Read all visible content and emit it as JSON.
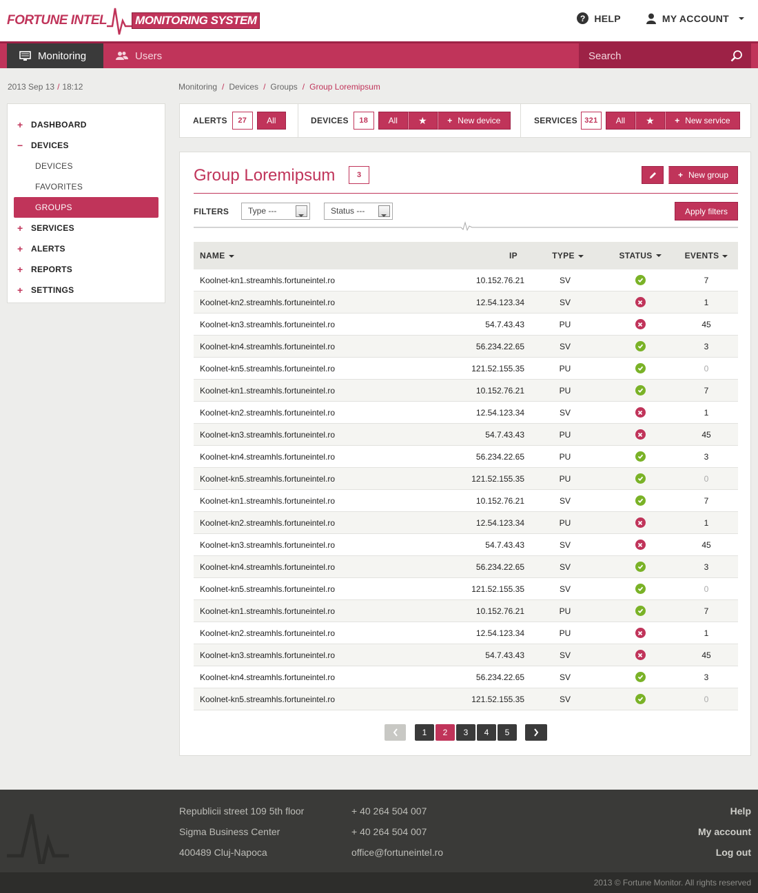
{
  "header": {
    "logo_left": "FORTUNE INTEL",
    "logo_right": "MONITORING SYSTEM",
    "help": "HELP",
    "account": "MY ACCOUNT"
  },
  "nav": {
    "monitoring": "Monitoring",
    "users": "Users",
    "search_placeholder": "Search"
  },
  "datetime": {
    "date": "2013 Sep 13",
    "time": "18:12"
  },
  "breadcrumb": [
    "Monitoring",
    "Devices",
    "Groups",
    "Group Loremipsum"
  ],
  "sidebar": {
    "dashboard": "DASHBOARD",
    "devices": "DEVICES",
    "devices_sub": "DEVICES",
    "favorites": "FAVORITES",
    "groups": "GROUPS",
    "services": "SERVICES",
    "alerts": "ALERTS",
    "reports": "REPORTS",
    "settings": "SETTINGS"
  },
  "stats": {
    "alerts_label": "ALERTS",
    "alerts_count": "27",
    "alerts_all": "All",
    "devices_label": "DEVICES",
    "devices_count": "18",
    "devices_all": "All",
    "new_device": "New device",
    "services_label": "SERVICES",
    "services_count": "321",
    "services_all": "All",
    "new_service": "New service"
  },
  "group": {
    "title": "Group Loremipsum",
    "count": "3",
    "new_group": "New group",
    "filters_label": "FILTERS",
    "type_select": "Type ---",
    "status_select": "Status ---",
    "apply": "Apply filters"
  },
  "table": {
    "headers": {
      "name": "NAME",
      "ip": "IP",
      "type": "TYPE",
      "status": "STATUS",
      "events": "EVENTS"
    },
    "rows": [
      {
        "name": "Koolnet-kn1.streamhls.fortuneintel.ro",
        "ip": "10.152.76.21",
        "type": "SV",
        "status": "ok",
        "events": "7"
      },
      {
        "name": "Koolnet-kn2.streamhls.fortuneintel.ro",
        "ip": "12.54.123.34",
        "type": "SV",
        "status": "error",
        "events": "1"
      },
      {
        "name": "Koolnet-kn3.streamhls.fortuneintel.ro",
        "ip": "54.7.43.43",
        "type": "PU",
        "status": "error",
        "events": "45"
      },
      {
        "name": "Koolnet-kn4.streamhls.fortuneintel.ro",
        "ip": "56.234.22.65",
        "type": "SV",
        "status": "ok",
        "events": "3"
      },
      {
        "name": "Koolnet-kn5.streamhls.fortuneintel.ro",
        "ip": "121.52.155.35",
        "type": "PU",
        "status": "ok",
        "events": "0"
      },
      {
        "name": "Koolnet-kn1.streamhls.fortuneintel.ro",
        "ip": "10.152.76.21",
        "type": "PU",
        "status": "ok",
        "events": "7"
      },
      {
        "name": "Koolnet-kn2.streamhls.fortuneintel.ro",
        "ip": "12.54.123.34",
        "type": "SV",
        "status": "error",
        "events": "1"
      },
      {
        "name": "Koolnet-kn3.streamhls.fortuneintel.ro",
        "ip": "54.7.43.43",
        "type": "PU",
        "status": "error",
        "events": "45"
      },
      {
        "name": "Koolnet-kn4.streamhls.fortuneintel.ro",
        "ip": "56.234.22.65",
        "type": "PU",
        "status": "ok",
        "events": "3"
      },
      {
        "name": "Koolnet-kn5.streamhls.fortuneintel.ro",
        "ip": "121.52.155.35",
        "type": "PU",
        "status": "ok",
        "events": "0"
      },
      {
        "name": "Koolnet-kn1.streamhls.fortuneintel.ro",
        "ip": "10.152.76.21",
        "type": "SV",
        "status": "ok",
        "events": "7"
      },
      {
        "name": "Koolnet-kn2.streamhls.fortuneintel.ro",
        "ip": "12.54.123.34",
        "type": "PU",
        "status": "error",
        "events": "1"
      },
      {
        "name": "Koolnet-kn3.streamhls.fortuneintel.ro",
        "ip": "54.7.43.43",
        "type": "SV",
        "status": "error",
        "events": "45"
      },
      {
        "name": "Koolnet-kn4.streamhls.fortuneintel.ro",
        "ip": "56.234.22.65",
        "type": "SV",
        "status": "ok",
        "events": "3"
      },
      {
        "name": "Koolnet-kn5.streamhls.fortuneintel.ro",
        "ip": "121.52.155.35",
        "type": "SV",
        "status": "ok",
        "events": "0"
      },
      {
        "name": "Koolnet-kn1.streamhls.fortuneintel.ro",
        "ip": "10.152.76.21",
        "type": "PU",
        "status": "ok",
        "events": "7"
      },
      {
        "name": "Koolnet-kn2.streamhls.fortuneintel.ro",
        "ip": "12.54.123.34",
        "type": "PU",
        "status": "error",
        "events": "1"
      },
      {
        "name": "Koolnet-kn3.streamhls.fortuneintel.ro",
        "ip": "54.7.43.43",
        "type": "SV",
        "status": "error",
        "events": "45"
      },
      {
        "name": "Koolnet-kn4.streamhls.fortuneintel.ro",
        "ip": "56.234.22.65",
        "type": "SV",
        "status": "ok",
        "events": "3"
      },
      {
        "name": "Koolnet-kn5.streamhls.fortuneintel.ro",
        "ip": "121.52.155.35",
        "type": "SV",
        "status": "ok",
        "events": "0"
      }
    ]
  },
  "pagination": {
    "pages": [
      "1",
      "2",
      "3",
      "4",
      "5"
    ],
    "current": "2"
  },
  "footer": {
    "address1": "Republicii street 109 5th floor",
    "address2": "Sigma Business Center",
    "address3": "400489 Cluj-Napoca",
    "phone1": "+ 40 264 504 007",
    "phone2": "+ 40 264 504 007",
    "email": "office@fortuneintel.ro",
    "help": "Help",
    "account": "My account",
    "logout": "Log out",
    "copyright": "2013 © Fortune Monitor. All rights reserved"
  },
  "colors": {
    "accent": "#c0345a",
    "dark": "#3a3a3a",
    "ok": "#7ab227"
  },
  "icons": {
    "help": "question-circle-icon",
    "account": "user-icon",
    "monitoring": "monitor-icon",
    "users": "users-icon",
    "search": "search-icon",
    "edit": "pencil-icon",
    "star": "star-icon",
    "plus": "plus-icon",
    "ok": "check-circle-icon",
    "error": "x-circle-icon"
  }
}
